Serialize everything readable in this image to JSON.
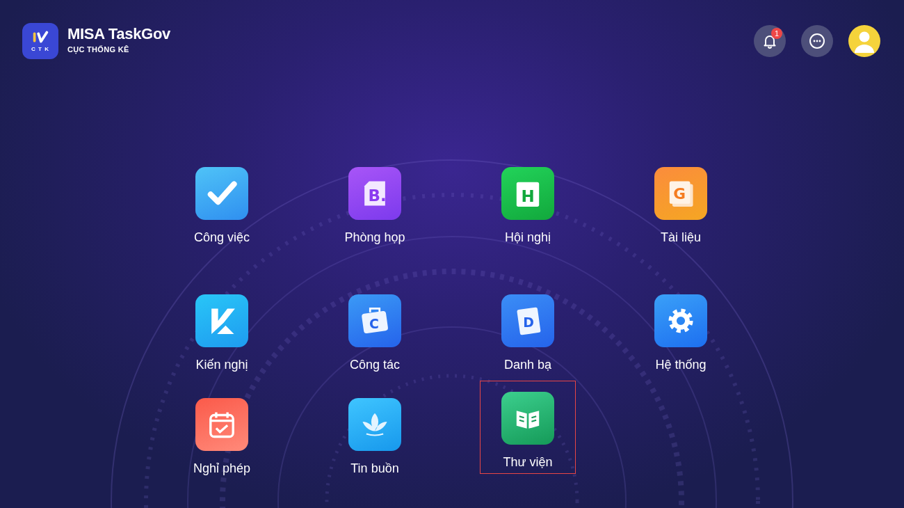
{
  "header": {
    "logo_text": "C T K",
    "title": "MISA TaskGov",
    "subtitle": "CỤC THỐNG KÊ",
    "notification_count": "1"
  },
  "apps": [
    {
      "label": "Công việc",
      "selected": false
    },
    {
      "label": "Phòng họp",
      "selected": false,
      "glyph": "B."
    },
    {
      "label": "Hội nghị",
      "selected": false,
      "glyph": "H"
    },
    {
      "label": "Tài liệu",
      "selected": false,
      "glyph": "G"
    },
    {
      "label": "Kiến nghị",
      "selected": false
    },
    {
      "label": "Công tác",
      "selected": false,
      "glyph": "C"
    },
    {
      "label": "Danh bạ",
      "selected": false,
      "glyph": "D"
    },
    {
      "label": "Hệ thống",
      "selected": false
    },
    {
      "label": "Nghỉ phép",
      "selected": false
    },
    {
      "label": "Tin buồn",
      "selected": false
    },
    {
      "label": "Thư viện",
      "selected": true
    }
  ]
}
